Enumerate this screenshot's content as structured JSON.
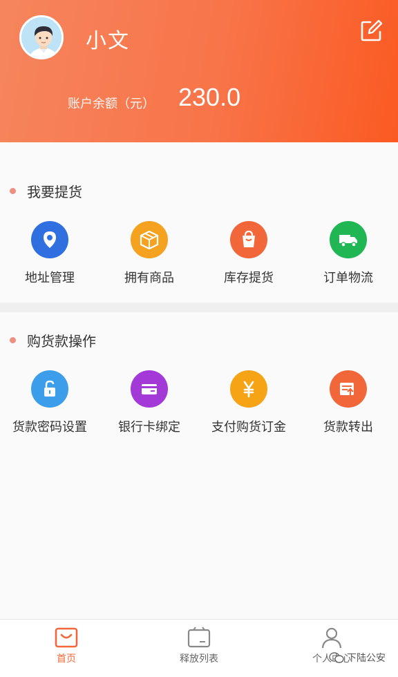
{
  "header": {
    "username": "小文",
    "balance_label": "账户余额（元）",
    "balance_value": "230.0",
    "avatar_icon": "user-avatar",
    "edit_icon": "edit-icon"
  },
  "pickup_section": {
    "title": "我要提货",
    "items": [
      {
        "label": "地址管理",
        "icon": "location-pin-icon",
        "color": "#2f6fe0"
      },
      {
        "label": "拥有商品",
        "icon": "package-box-icon",
        "color": "#f4a21f"
      },
      {
        "label": "库存提货",
        "icon": "shopping-bag-icon",
        "color": "#f2673a"
      },
      {
        "label": "订单物流",
        "icon": "delivery-truck-icon",
        "color": "#1fb653"
      }
    ]
  },
  "payment_section": {
    "title": "购货款操作",
    "items": [
      {
        "label": "货款密码设置",
        "icon": "unlock-icon",
        "color": "#3c9eea"
      },
      {
        "label": "银行卡绑定",
        "icon": "bank-card-icon",
        "color": "#a33ad8"
      },
      {
        "label": "支付购货订金",
        "icon": "yen-icon",
        "color": "#f6a316"
      },
      {
        "label": "货款转出",
        "icon": "transfer-out-icon",
        "color": "#f2673a"
      }
    ]
  },
  "tabbar": {
    "tabs": [
      {
        "label": "首页",
        "icon": "home-bag-icon",
        "active": true
      },
      {
        "label": "释放列表",
        "icon": "list-box-icon",
        "active": false
      },
      {
        "label": "个人中心",
        "icon": "person-icon",
        "active": false
      }
    ]
  },
  "watermark": "下陆公安",
  "colors": {
    "accent": "#f87449",
    "active_tab": "#f2673a"
  }
}
